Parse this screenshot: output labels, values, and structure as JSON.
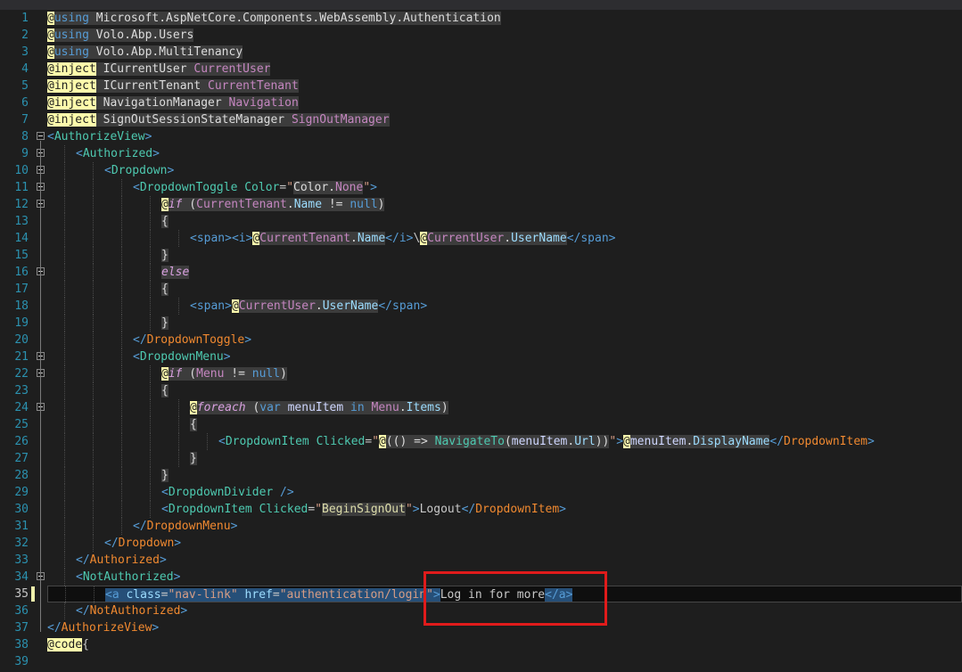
{
  "editor": {
    "cursor_line": 35,
    "lines": [
      {
        "n": "1",
        "fold": false,
        "indent": 0,
        "tokens": [
          {
            "t": "@",
            "c": "rz"
          },
          {
            "t": "using",
            "c": "kw gr"
          },
          {
            "t": " Microsoft.AspNetCore.Components.WebAssembly.Authentication",
            "c": "gr"
          }
        ]
      },
      {
        "n": "2",
        "fold": false,
        "indent": 0,
        "tokens": [
          {
            "t": "@",
            "c": "rz"
          },
          {
            "t": "using",
            "c": "kw gr"
          },
          {
            "t": " Volo.Abp.Users",
            "c": "gr"
          }
        ]
      },
      {
        "n": "3",
        "fold": false,
        "indent": 0,
        "tokens": [
          {
            "t": "@",
            "c": "rz"
          },
          {
            "t": "using",
            "c": "kw gr"
          },
          {
            "t": " Volo.Abp.MultiTenancy",
            "c": "gr"
          }
        ]
      },
      {
        "n": "4",
        "fold": false,
        "indent": 0,
        "tokens": [
          {
            "t": "@inject",
            "c": "rz"
          },
          {
            "t": " ICurrentUser ",
            "c": "gr"
          },
          {
            "t": "CurrentUser",
            "c": "dr gr"
          }
        ]
      },
      {
        "n": "5",
        "fold": false,
        "indent": 0,
        "tokens": [
          {
            "t": "@inject",
            "c": "rz"
          },
          {
            "t": " ICurrentTenant ",
            "c": "gr"
          },
          {
            "t": "CurrentTenant",
            "c": "dr gr"
          }
        ]
      },
      {
        "n": "6",
        "fold": false,
        "indent": 0,
        "tokens": [
          {
            "t": "@inject",
            "c": "rz"
          },
          {
            "t": " NavigationManager ",
            "c": "gr"
          },
          {
            "t": "Navigation",
            "c": "dr gr"
          }
        ]
      },
      {
        "n": "7",
        "fold": false,
        "indent": 0,
        "tokens": [
          {
            "t": "@inject",
            "c": "rz"
          },
          {
            "t": " SignOutSessionStateManager ",
            "c": "gr"
          },
          {
            "t": "SignOutManager",
            "c": "dr gr"
          }
        ]
      },
      {
        "n": "8",
        "fold": true,
        "indent": 0,
        "tokens": [
          {
            "t": "<",
            "c": "tg"
          },
          {
            "t": "AuthorizeView",
            "c": "cm"
          },
          {
            "t": ">",
            "c": "tg"
          }
        ]
      },
      {
        "n": "9",
        "fold": true,
        "indent": 1,
        "tokens": [
          {
            "t": "<",
            "c": "tg"
          },
          {
            "t": "Authorized",
            "c": "cm"
          },
          {
            "t": ">",
            "c": "tg"
          }
        ]
      },
      {
        "n": "10",
        "fold": true,
        "indent": 2,
        "tokens": [
          {
            "t": "<",
            "c": "tg"
          },
          {
            "t": "Dropdown",
            "c": "cm"
          },
          {
            "t": ">",
            "c": "tg"
          }
        ]
      },
      {
        "n": "11",
        "fold": true,
        "indent": 3,
        "tokens": [
          {
            "t": "<",
            "c": "tg"
          },
          {
            "t": "DropdownToggle",
            "c": "cm"
          },
          {
            "t": " Color",
            "c": "cm"
          },
          {
            "t": "=",
            "c": "pp"
          },
          {
            "t": "\"",
            "c": "st"
          },
          {
            "t": "Color.",
            "c": "gr"
          },
          {
            "t": "None",
            "c": "dr gr"
          },
          {
            "t": "\"",
            "c": "st"
          },
          {
            "t": ">",
            "c": "tg"
          }
        ]
      },
      {
        "n": "12",
        "fold": true,
        "indent": 4,
        "tokens": [
          {
            "t": "@",
            "c": "rz"
          },
          {
            "t": "if",
            "c": "ctl it gr"
          },
          {
            "t": " (",
            "c": "gr"
          },
          {
            "t": "CurrentTenant",
            "c": "dr gr"
          },
          {
            "t": ".",
            "c": "gr"
          },
          {
            "t": "Name",
            "c": "at gr"
          },
          {
            "t": " != ",
            "c": "gr"
          },
          {
            "t": "null",
            "c": "kw gr"
          },
          {
            "t": ")",
            "c": "gr"
          }
        ]
      },
      {
        "n": "13",
        "fold": false,
        "indent": 4,
        "tokens": [
          {
            "t": "{",
            "c": "gr"
          }
        ]
      },
      {
        "n": "14",
        "fold": false,
        "indent": 5,
        "tokens": [
          {
            "t": "<",
            "c": "tg"
          },
          {
            "t": "span",
            "c": "tg"
          },
          {
            "t": ">",
            "c": "tg"
          },
          {
            "t": "<",
            "c": "tg"
          },
          {
            "t": "i",
            "c": "tg"
          },
          {
            "t": ">",
            "c": "tg"
          },
          {
            "t": "@",
            "c": "rz"
          },
          {
            "t": "CurrentTenant",
            "c": "dr gr"
          },
          {
            "t": ".",
            "c": "gr"
          },
          {
            "t": "Name",
            "c": "at gr"
          },
          {
            "t": "</",
            "c": "tg"
          },
          {
            "t": "i",
            "c": "tg"
          },
          {
            "t": ">",
            "c": "tg"
          },
          {
            "t": "\\",
            "c": "pp"
          },
          {
            "t": "@",
            "c": "rz"
          },
          {
            "t": "CurrentUser",
            "c": "dr gr"
          },
          {
            "t": ".",
            "c": "gr"
          },
          {
            "t": "UserName",
            "c": "at gr"
          },
          {
            "t": "</",
            "c": "tg"
          },
          {
            "t": "span",
            "c": "tg"
          },
          {
            "t": ">",
            "c": "tg"
          }
        ]
      },
      {
        "n": "15",
        "fold": false,
        "indent": 4,
        "tokens": [
          {
            "t": "}",
            "c": "gr"
          }
        ]
      },
      {
        "n": "16",
        "fold": true,
        "indent": 4,
        "tokens": [
          {
            "t": "else",
            "c": "ctl it gr"
          }
        ]
      },
      {
        "n": "17",
        "fold": false,
        "indent": 4,
        "tokens": [
          {
            "t": "{",
            "c": "gr"
          }
        ]
      },
      {
        "n": "18",
        "fold": false,
        "indent": 5,
        "tokens": [
          {
            "t": "<",
            "c": "tg"
          },
          {
            "t": "span",
            "c": "tg"
          },
          {
            "t": ">",
            "c": "tg"
          },
          {
            "t": "@",
            "c": "rz"
          },
          {
            "t": "CurrentUser",
            "c": "dr gr"
          },
          {
            "t": ".",
            "c": "gr"
          },
          {
            "t": "UserName",
            "c": "at gr"
          },
          {
            "t": "</",
            "c": "tg"
          },
          {
            "t": "span",
            "c": "tg"
          },
          {
            "t": ">",
            "c": "tg"
          }
        ]
      },
      {
        "n": "19",
        "fold": false,
        "indent": 4,
        "tokens": [
          {
            "t": "}",
            "c": "gr"
          }
        ]
      },
      {
        "n": "20",
        "fold": false,
        "indent": 3,
        "tokens": [
          {
            "t": "</",
            "c": "tg"
          },
          {
            "t": "DropdownToggle",
            "c": "or"
          },
          {
            "t": ">",
            "c": "tg"
          }
        ]
      },
      {
        "n": "21",
        "fold": true,
        "indent": 3,
        "tokens": [
          {
            "t": "<",
            "c": "tg"
          },
          {
            "t": "DropdownMenu",
            "c": "cm"
          },
          {
            "t": ">",
            "c": "tg"
          }
        ]
      },
      {
        "n": "22",
        "fold": true,
        "indent": 4,
        "tokens": [
          {
            "t": "@",
            "c": "rz"
          },
          {
            "t": "if",
            "c": "ctl it gr"
          },
          {
            "t": " (",
            "c": "gr"
          },
          {
            "t": "Menu",
            "c": "dr gr"
          },
          {
            "t": " != ",
            "c": "gr"
          },
          {
            "t": "null",
            "c": "kw gr"
          },
          {
            "t": ")",
            "c": "gr"
          }
        ]
      },
      {
        "n": "23",
        "fold": false,
        "indent": 4,
        "tokens": [
          {
            "t": "{",
            "c": "gr"
          }
        ]
      },
      {
        "n": "24",
        "fold": true,
        "indent": 5,
        "tokens": [
          {
            "t": "@",
            "c": "rz"
          },
          {
            "t": "foreach",
            "c": "ctl it gr"
          },
          {
            "t": " (",
            "c": "gr"
          },
          {
            "t": "var",
            "c": "kw gr"
          },
          {
            "t": " ",
            "c": "gr"
          },
          {
            "t": "menuItem",
            "c": "ip gr"
          },
          {
            "t": " ",
            "c": "gr"
          },
          {
            "t": "in",
            "c": "kw gr"
          },
          {
            "t": " ",
            "c": "gr"
          },
          {
            "t": "Menu",
            "c": "dr gr"
          },
          {
            "t": ".",
            "c": "gr"
          },
          {
            "t": "Items",
            "c": "at gr"
          },
          {
            "t": ")",
            "c": "gr"
          }
        ]
      },
      {
        "n": "25",
        "fold": false,
        "indent": 5,
        "tokens": [
          {
            "t": "{",
            "c": "gr"
          }
        ]
      },
      {
        "n": "26",
        "fold": false,
        "indent": 6,
        "tokens": [
          {
            "t": "<",
            "c": "tg"
          },
          {
            "t": "DropdownItem",
            "c": "cm"
          },
          {
            "t": " Clicked",
            "c": "cm"
          },
          {
            "t": "=",
            "c": "pp"
          },
          {
            "t": "\"",
            "c": "st"
          },
          {
            "t": "@",
            "c": "rz"
          },
          {
            "t": "(() => ",
            "c": "gr"
          },
          {
            "t": "NavigateTo",
            "c": "mt gr"
          },
          {
            "t": "(",
            "c": "gr"
          },
          {
            "t": "menuItem",
            "c": "ip gr"
          },
          {
            "t": ".",
            "c": "gr"
          },
          {
            "t": "Url",
            "c": "at gr"
          },
          {
            "t": "))",
            "c": "gr"
          },
          {
            "t": "\"",
            "c": "st"
          },
          {
            "t": ">",
            "c": "tg"
          },
          {
            "t": "@",
            "c": "rz"
          },
          {
            "t": "menuItem",
            "c": "ip gr"
          },
          {
            "t": ".",
            "c": "gr"
          },
          {
            "t": "DisplayName",
            "c": "at gr"
          },
          {
            "t": "</",
            "c": "tg"
          },
          {
            "t": "DropdownItem",
            "c": "or"
          },
          {
            "t": ">",
            "c": "tg"
          }
        ]
      },
      {
        "n": "27",
        "fold": false,
        "indent": 5,
        "tokens": [
          {
            "t": "}",
            "c": "gr"
          }
        ]
      },
      {
        "n": "28",
        "fold": false,
        "indent": 4,
        "tokens": [
          {
            "t": "}",
            "c": "gr"
          }
        ]
      },
      {
        "n": "29",
        "fold": false,
        "indent": 4,
        "tokens": [
          {
            "t": "<",
            "c": "tg"
          },
          {
            "t": "DropdownDivider",
            "c": "cm"
          },
          {
            "t": " />",
            "c": "tg"
          }
        ]
      },
      {
        "n": "30",
        "fold": false,
        "indent": 4,
        "tokens": [
          {
            "t": "<",
            "c": "tg"
          },
          {
            "t": "DropdownItem",
            "c": "cm"
          },
          {
            "t": " Clicked",
            "c": "cm"
          },
          {
            "t": "=",
            "c": "pp"
          },
          {
            "t": "\"",
            "c": "st"
          },
          {
            "t": "BeginSignOut",
            "c": "fn gr"
          },
          {
            "t": "\"",
            "c": "st"
          },
          {
            "t": ">",
            "c": "tg"
          },
          {
            "t": "Logout",
            "c": "pp"
          },
          {
            "t": "</",
            "c": "tg"
          },
          {
            "t": "DropdownItem",
            "c": "or"
          },
          {
            "t": ">",
            "c": "tg"
          }
        ]
      },
      {
        "n": "31",
        "fold": false,
        "indent": 3,
        "tokens": [
          {
            "t": "</",
            "c": "tg"
          },
          {
            "t": "DropdownMenu",
            "c": "or"
          },
          {
            "t": ">",
            "c": "tg"
          }
        ]
      },
      {
        "n": "32",
        "fold": false,
        "indent": 2,
        "tokens": [
          {
            "t": "</",
            "c": "tg"
          },
          {
            "t": "Dropdown",
            "c": "or"
          },
          {
            "t": ">",
            "c": "tg"
          }
        ]
      },
      {
        "n": "33",
        "fold": false,
        "indent": 1,
        "tokens": [
          {
            "t": "</",
            "c": "tg"
          },
          {
            "t": "Authorized",
            "c": "or"
          },
          {
            "t": ">",
            "c": "tg"
          }
        ]
      },
      {
        "n": "34",
        "fold": true,
        "indent": 1,
        "tokens": [
          {
            "t": "<",
            "c": "tg"
          },
          {
            "t": "NotAuthorized",
            "c": "cm"
          },
          {
            "t": ">",
            "c": "tg"
          }
        ]
      },
      {
        "n": "35",
        "fold": false,
        "indent": 2,
        "tokens": [
          {
            "t": "<a",
            "c": "tg sel"
          },
          {
            "t": " class",
            "c": "at sel"
          },
          {
            "t": "=",
            "c": "pp sel"
          },
          {
            "t": "\"nav-link\"",
            "c": "st sel"
          },
          {
            "t": " href",
            "c": "at sel"
          },
          {
            "t": "=",
            "c": "pp sel"
          },
          {
            "t": "\"authentication/login\"",
            "c": "st sel"
          },
          {
            "t": ">",
            "c": "tg sel"
          },
          {
            "t": "Log in for more",
            "c": "pp"
          },
          {
            "t": "</a>",
            "c": "tg sel"
          }
        ]
      },
      {
        "n": "36",
        "fold": false,
        "indent": 1,
        "tokens": [
          {
            "t": "</",
            "c": "tg"
          },
          {
            "t": "NotAuthorized",
            "c": "or"
          },
          {
            "t": ">",
            "c": "tg"
          }
        ]
      },
      {
        "n": "37",
        "fold": false,
        "indent": 0,
        "tokens": [
          {
            "t": "</",
            "c": "tg"
          },
          {
            "t": "AuthorizeView",
            "c": "or"
          },
          {
            "t": ">",
            "c": "tg"
          }
        ]
      },
      {
        "n": "38",
        "fold": false,
        "indent": 0,
        "tokens": [
          {
            "t": "@code",
            "c": "rz"
          },
          {
            "t": "{",
            "c": "pp"
          }
        ]
      },
      {
        "n": "39",
        "fold": false,
        "indent": 0,
        "tokens": []
      }
    ]
  }
}
